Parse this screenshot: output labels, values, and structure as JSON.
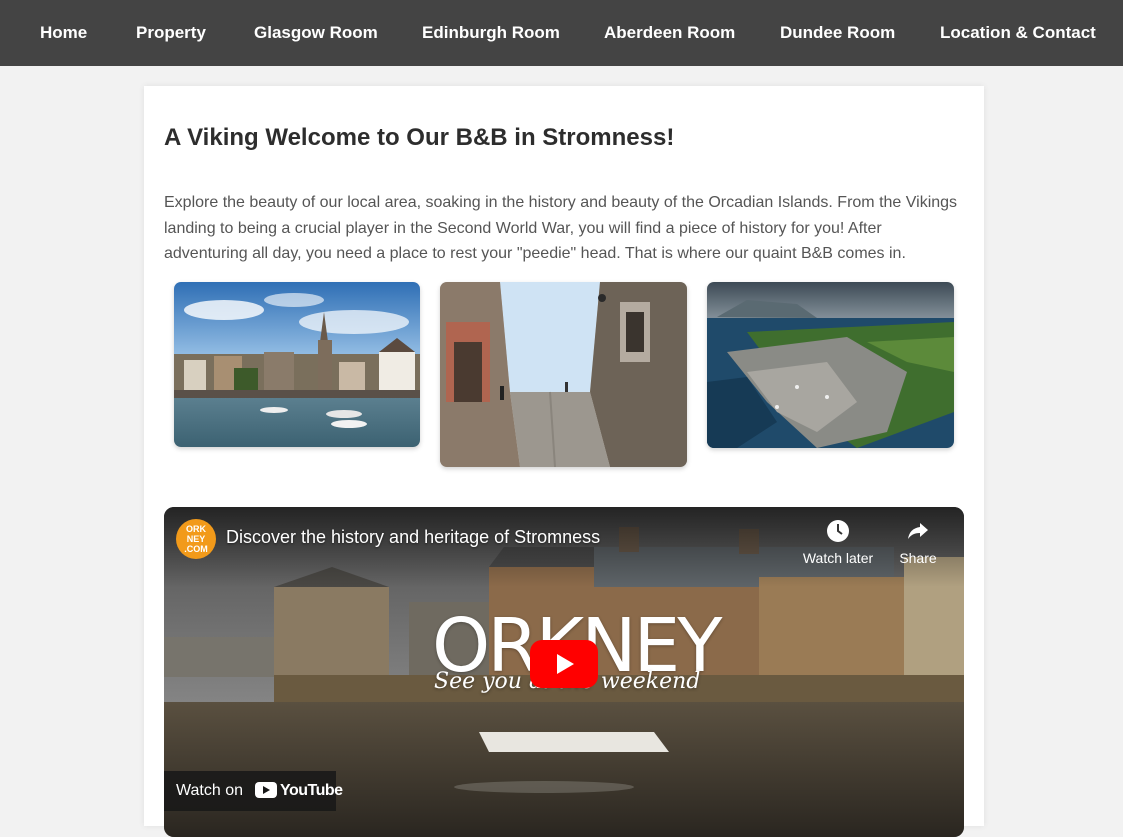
{
  "nav": {
    "items": [
      {
        "label": "Home"
      },
      {
        "label": "Property"
      },
      {
        "label": "Glasgow Room"
      },
      {
        "label": "Edinburgh Room"
      },
      {
        "label": "Aberdeen Room"
      },
      {
        "label": "Dundee Room"
      },
      {
        "label": "Location & Contact"
      }
    ]
  },
  "main": {
    "title": "A Viking Welcome to Our B&B in Stromness!",
    "intro": "Explore the beauty of our local area, soaking in the history and beauty of the Orcadian Islands. From the Vikings landing to being a crucial player in the Second World War, you will find a piece of history for you! After adventuring all day, you need a place to rest your \"peedie\" head. That is where our quaint B&B comes in."
  },
  "video": {
    "title": "Discover the history and heritage of Stromness",
    "channel_logo_text": "ORK NEY .COM",
    "watch_later_label": "Watch later",
    "share_label": "Share",
    "brand_word": "ORKNEY",
    "brand_tagline": "See you at the weekend",
    "watch_on_label": "Watch on",
    "youtube_label": "YouTube"
  },
  "colors": {
    "nav_bg": "#444444",
    "page_bg": "#f2f2f2",
    "card_bg": "#ffffff",
    "title_text": "#2d2d2d",
    "body_text": "#555555",
    "play_red": "#ff0000",
    "channel_orange": "#f29a1a"
  },
  "icons": [
    "clock-icon",
    "share-icon",
    "play-icon",
    "youtube-logo-icon"
  ]
}
